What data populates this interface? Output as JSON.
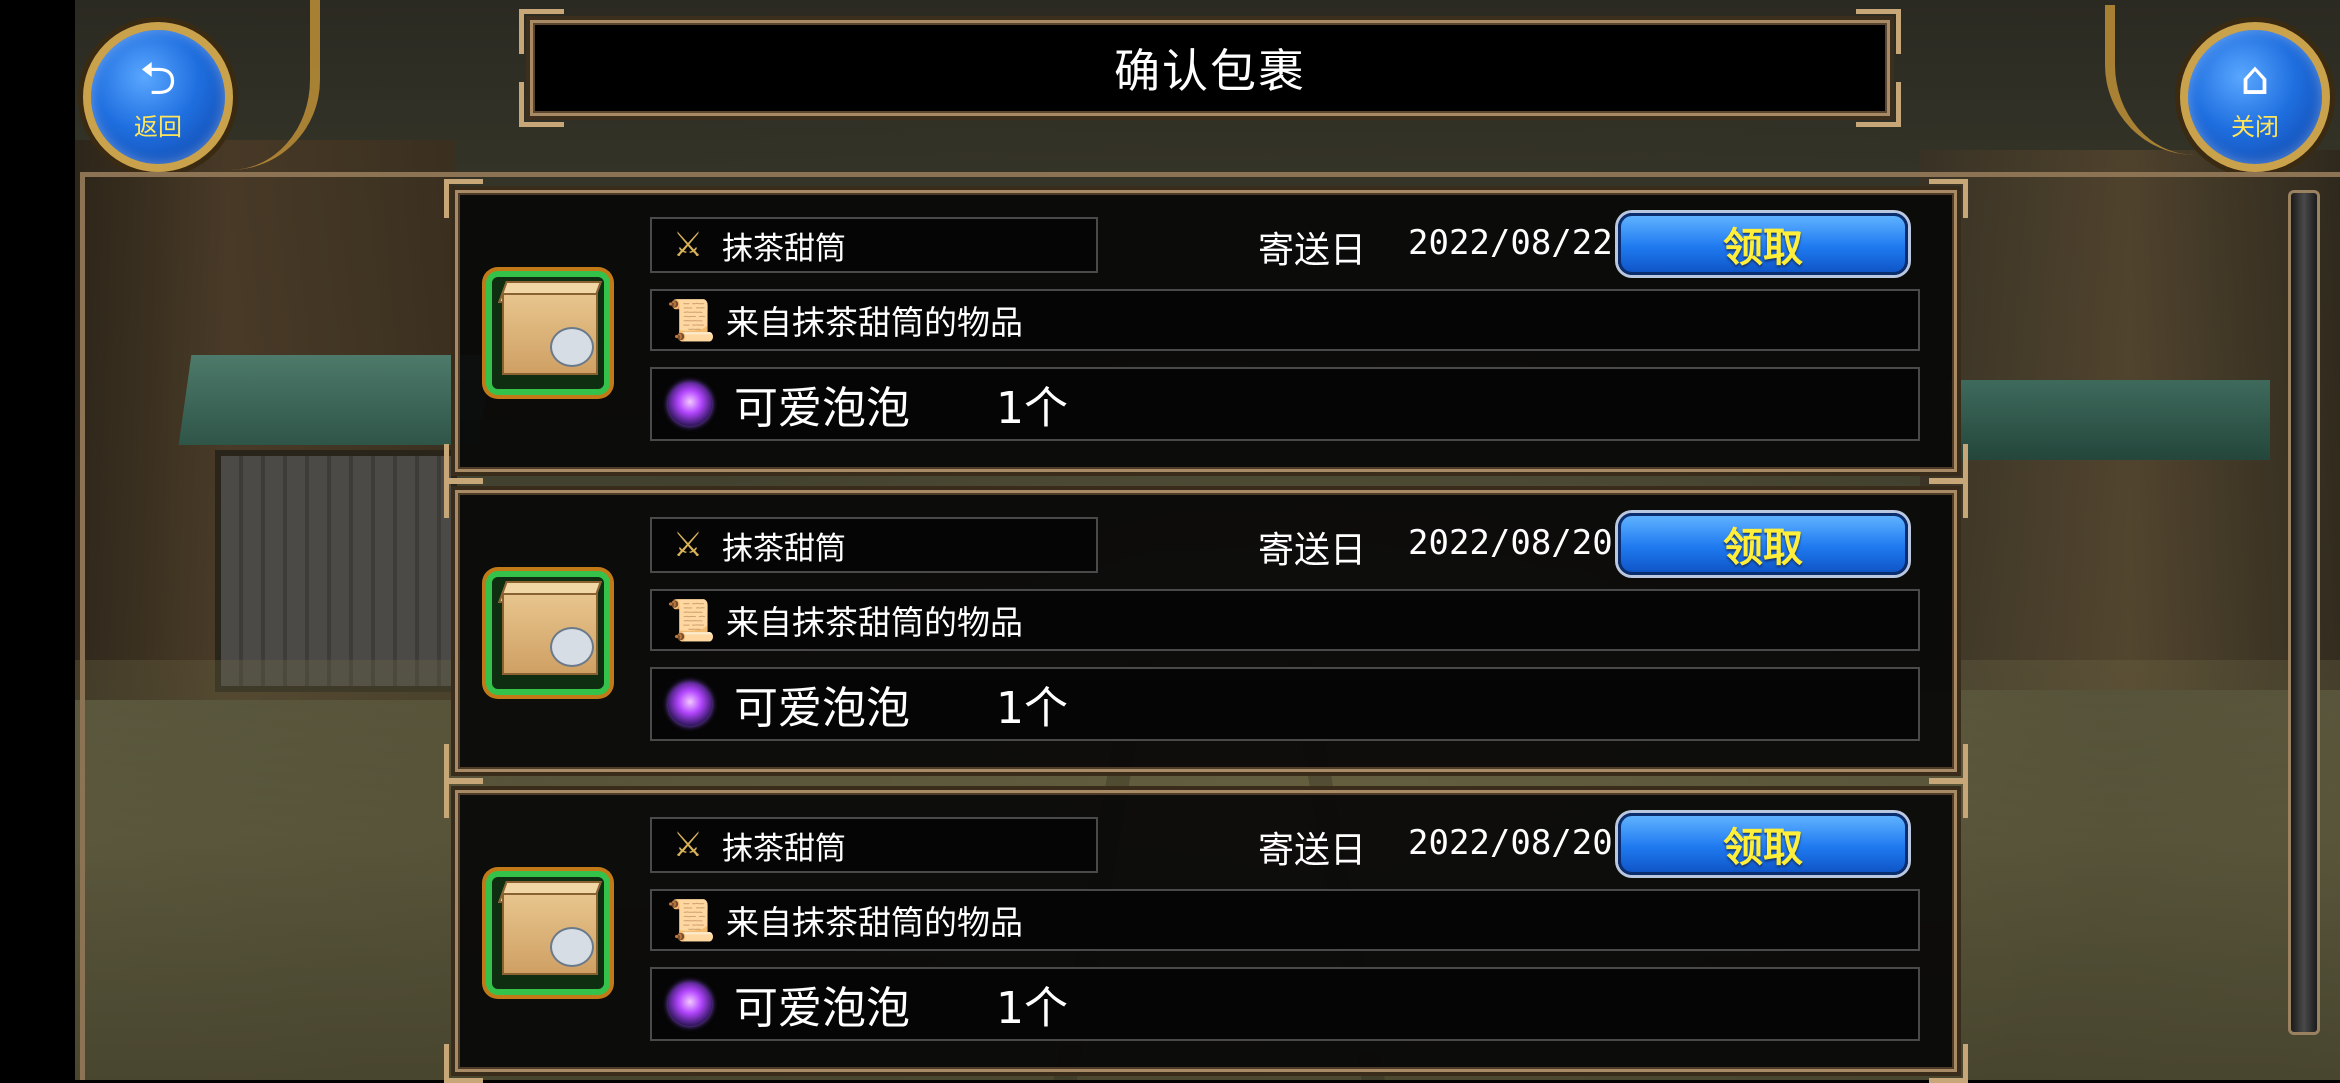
{
  "header": {
    "title": "确认包裹"
  },
  "nav": {
    "back": {
      "glyph": "⮌",
      "label": "返回"
    },
    "close": {
      "glyph": "⌂",
      "label": "关闭"
    }
  },
  "parcels": [
    {
      "sender": "抹茶甜筒",
      "date_label": "寄送日",
      "date": "2022/08/22",
      "claim_label": "领取",
      "message": "来自抹茶甜筒的物品",
      "item_name": "可爱泡泡",
      "item_qty": "1个"
    },
    {
      "sender": "抹茶甜筒",
      "date_label": "寄送日",
      "date": "2022/08/20",
      "claim_label": "领取",
      "message": "来自抹茶甜筒的物品",
      "item_name": "可爱泡泡",
      "item_qty": "1个"
    },
    {
      "sender": "抹茶甜筒",
      "date_label": "寄送日",
      "date": "2022/08/20",
      "claim_label": "领取",
      "message": "来自抹茶甜筒的物品",
      "item_name": "可爱泡泡",
      "item_qty": "1个"
    }
  ],
  "icons": {
    "package": "package-box-icon",
    "sender": "sword-shield-icon",
    "letter": "scroll-letter-icon",
    "item": "purple-orb-icon"
  },
  "colors": {
    "claim_button": "#1f7af0",
    "claim_text": "#ffef3a",
    "frame_gold": "#a88b64",
    "package_border": "#35c24a",
    "nav_label": "#ffe55a"
  }
}
